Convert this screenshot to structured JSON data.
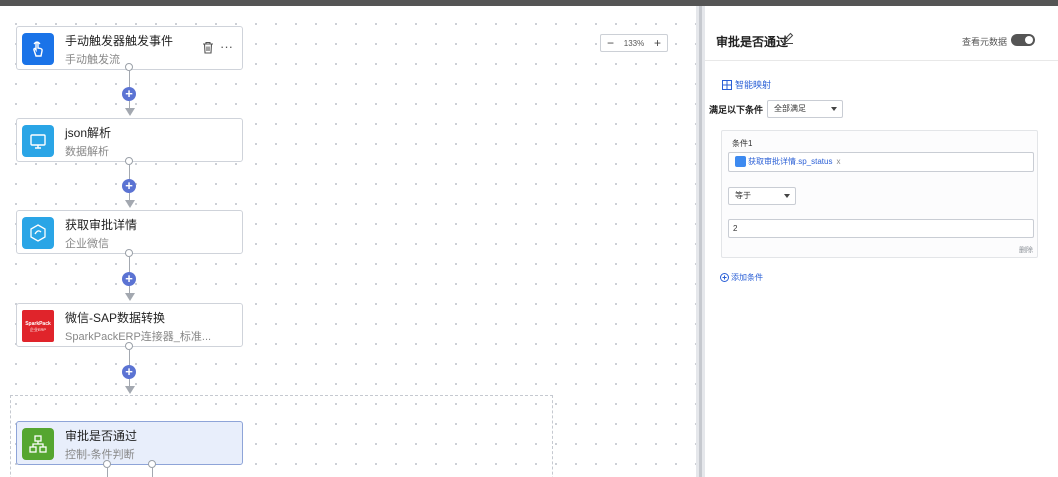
{
  "canvas": {
    "zoom_level": "133%",
    "zoom_out": "−",
    "zoom_in": "+",
    "nodes": [
      {
        "title": "手动触发器触发事件",
        "subtitle": "手动触发流",
        "icon": "hand-pointer-icon",
        "color": "#1a73e8"
      },
      {
        "title": "json解析",
        "subtitle": "数据解析",
        "icon": "monitor-icon",
        "color": "#2aa5e6"
      },
      {
        "title": "获取审批详情",
        "subtitle": "企业微信",
        "icon": "wecom-icon",
        "color": "#2aa5e6"
      },
      {
        "title": "微信-SAP数据转换",
        "subtitle": "SparkPackERP连接器_标准...",
        "icon": "sparkpack-logo",
        "color": "#e0242b",
        "logo_text_1": "SparkPack",
        "logo_text_2": "企业ERP"
      },
      {
        "title": "审批是否通过",
        "subtitle": "控制-条件判断",
        "icon": "branch-icon",
        "color": "#55a630"
      }
    ],
    "node_actions": {
      "more": "···"
    }
  },
  "panel": {
    "title": "审批是否通过",
    "view_metadata_label": "查看元数据",
    "metadata_toggle_on": false,
    "smart_mapping": "智能映射",
    "condition_label": "满足以下条件",
    "condition_mode": "全部满足",
    "condition": {
      "name": "条件1",
      "field": "获取审批详情.sp_status",
      "field_remove": "x",
      "operator": "等于",
      "value": "2",
      "delete_label": "删除"
    },
    "add_condition": "添加条件"
  }
}
